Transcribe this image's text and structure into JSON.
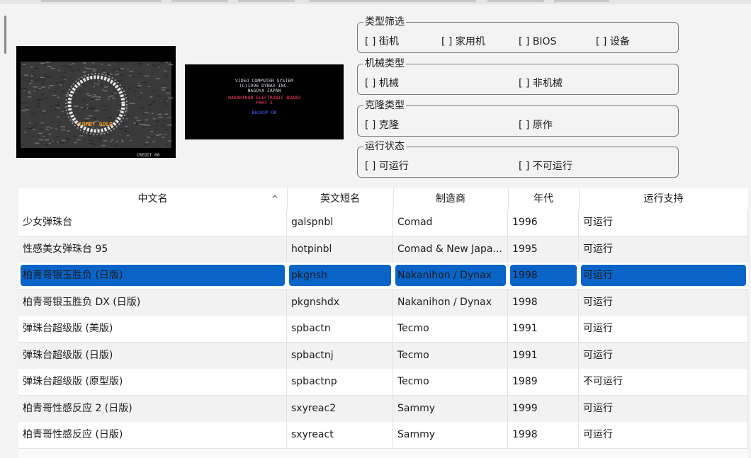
{
  "filters": {
    "type_filter": {
      "title": "类型筛选",
      "options": [
        "[  ] 街机",
        "[  ] 家用机",
        "[  ] BIOS",
        "[  ] 设备"
      ]
    },
    "machine_type": {
      "title": "机械类型",
      "options": [
        "[  ] 机械",
        "[  ] 非机械"
      ]
    },
    "clone_type": {
      "title": "克隆类型",
      "options": [
        "[  ] 克隆",
        "[  ] 原作"
      ]
    },
    "run_status": {
      "title": "运行状态",
      "options": [
        "[  ] 可运行",
        "[  ] 不可运行"
      ]
    }
  },
  "table": {
    "columns": [
      "中文名",
      "英文短名",
      "制造商",
      "年代",
      "运行支持"
    ],
    "sort_indicator": "^",
    "selected_row": 2,
    "rows": [
      [
        "少女弹珠台",
        "galspnbl",
        "Comad",
        "1996",
        "可运行"
      ],
      [
        "性感美女弹珠台 95",
        "hotpinbl",
        "Comad & New Japa...",
        "1995",
        "可运行"
      ],
      [
        "柏青哥银玉胜负 (日版)",
        "pkgnsh",
        "Nakanihon / Dynax",
        "1998",
        "可运行"
      ],
      [
        "柏青哥银玉胜负 DX (日版)",
        "pkgnshdx",
        "Nakanihon / Dynax",
        "1998",
        "可运行"
      ],
      [
        "弹珠台超级版 (美版)",
        "spbactn",
        "Tecmo",
        "1991",
        "可运行"
      ],
      [
        "弹珠台超级版 (日版)",
        "spbactnj",
        "Tecmo",
        "1991",
        "可运行"
      ],
      [
        "弹珠台超级版 (原型版)",
        "spbactnp",
        "Tecmo",
        "1989",
        "不可运行"
      ],
      [
        "柏青哥性感反应 2 (日版)",
        "sxyreac2",
        "Sammy",
        "1999",
        "可运行"
      ],
      [
        "柏青哥性感反应 (日版)",
        "sxyreact",
        "Sammy",
        "1998",
        "可运行"
      ]
    ]
  },
  "snapshot_title": {
    "logo_text": "COMET GOLD",
    "credit": "CREDIT 00"
  },
  "snapshot_boot": {
    "lines": [
      "VIDEO COMPUTER SYSTEM",
      "(C)1996 DYNAX INC.",
      "NAGOYA JAPAN",
      "NAKANIHON ELECTRONIC BOARD",
      "PART  3",
      "BACKUP OK"
    ]
  },
  "colors": {
    "selection": "#0a64c8",
    "boot_red": "#ff3a6a",
    "boot_blue": "#4a6cff",
    "boot_white": "#d8d8e8"
  }
}
